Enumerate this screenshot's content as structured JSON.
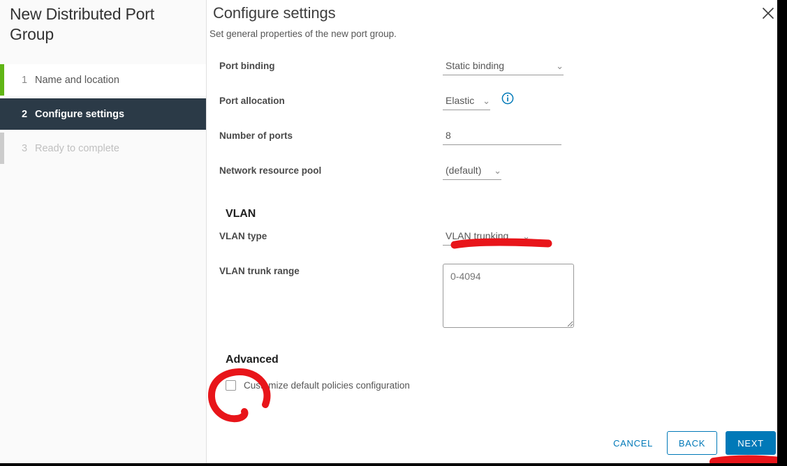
{
  "sidebar": {
    "title": "New Distributed Port Group",
    "steps": [
      {
        "num": "1",
        "label": "Name and location",
        "state": "done"
      },
      {
        "num": "2",
        "label": "Configure settings",
        "state": "current"
      },
      {
        "num": "3",
        "label": "Ready to complete",
        "state": "upcoming"
      }
    ]
  },
  "pane": {
    "title": "Configure settings",
    "subtitle": "Set general properties of the new port group."
  },
  "fields": {
    "port_binding": {
      "label": "Port binding",
      "value": "Static binding",
      "caret": "⌄"
    },
    "port_allocation": {
      "label": "Port allocation",
      "value": "Elastic",
      "caret": "⌄",
      "info_icon": "info-circle-icon"
    },
    "number_of_ports": {
      "label": "Number of ports",
      "value": "8"
    },
    "network_resource_pool": {
      "label": "Network resource pool",
      "value": "(default)",
      "caret": "⌄"
    }
  },
  "vlan": {
    "heading": "VLAN",
    "type": {
      "label": "VLAN type",
      "value": "VLAN trunking",
      "caret": "⌄"
    },
    "trunk_range": {
      "label": "VLAN trunk range",
      "placeholder": "0-4094",
      "value": ""
    }
  },
  "advanced": {
    "heading": "Advanced",
    "customize": {
      "label": "Customize default policies configuration",
      "checked": false
    }
  },
  "footer": {
    "cancel_label": "CANCEL",
    "back_label": "BACK",
    "next_label": "NEXT"
  },
  "window": {
    "close_icon": "close-x-icon"
  },
  "colors": {
    "accent_blue": "#0079b8",
    "step_current_bg": "#2b3a47",
    "step_done_accent": "#60b515",
    "annotation_red": "#e8151a",
    "sidebar_bg": "#fafafa"
  },
  "annotations": [
    {
      "name": "vlan-type-underline",
      "shape": "marker-stroke"
    },
    {
      "name": "customize-checkbox-circle",
      "shape": "marker-loop"
    },
    {
      "name": "next-button-underline",
      "shape": "marker-stroke"
    }
  ]
}
